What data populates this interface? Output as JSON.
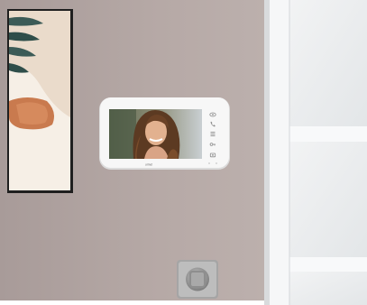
{
  "scene": {
    "wall_color": "#b4a6a3",
    "door_frame_color": "#f1f2f3",
    "glass_color": "#e9ebed",
    "frame_color": "#242424",
    "monitor_color": "#f7f7f7",
    "switch_color": "#9a9a9a"
  },
  "monitor": {
    "brand": "urmet",
    "side_icons": [
      "eye-icon",
      "phone-icon",
      "menu-icon",
      "key-icon",
      "camera-icon"
    ]
  }
}
